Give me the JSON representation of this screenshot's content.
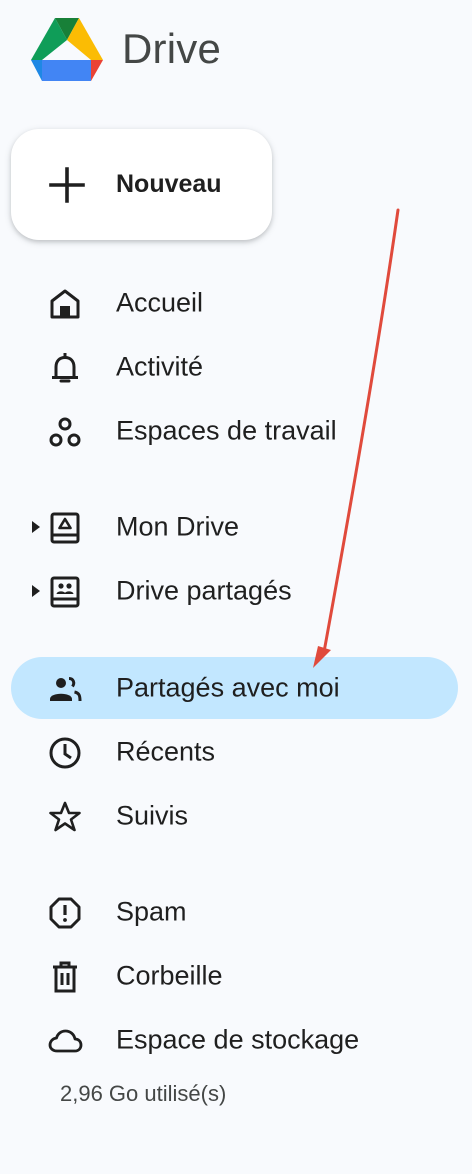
{
  "brand": {
    "title": "Drive",
    "logo_icon": "google-drive-logo"
  },
  "new_button": {
    "label": "Nouveau",
    "icon": "plus-icon"
  },
  "nav": {
    "items": [
      {
        "id": "home",
        "label": "Accueil",
        "icon": "home-icon",
        "active": false
      },
      {
        "id": "activity",
        "label": "Activité",
        "icon": "bell-icon",
        "active": false
      },
      {
        "id": "workspaces",
        "label": "Espaces de travail",
        "icon": "workspaces-icon",
        "active": false
      },
      {
        "id": "my-drive",
        "label": "Mon Drive",
        "icon": "my-drive-icon",
        "expandable": true,
        "active": false
      },
      {
        "id": "shared-drives",
        "label": "Drive partagés",
        "icon": "shared-drives-icon",
        "expandable": true,
        "active": false
      },
      {
        "id": "shared-with-me",
        "label": "Partagés avec moi",
        "icon": "people-icon",
        "active": true
      },
      {
        "id": "recent",
        "label": "Récents",
        "icon": "clock-icon",
        "active": false
      },
      {
        "id": "starred",
        "label": "Suivis",
        "icon": "star-icon",
        "active": false
      },
      {
        "id": "spam",
        "label": "Spam",
        "icon": "spam-icon",
        "active": false
      },
      {
        "id": "trash",
        "label": "Corbeille",
        "icon": "trash-icon",
        "active": false
      },
      {
        "id": "storage",
        "label": "Espace de stockage",
        "icon": "cloud-icon",
        "active": false
      }
    ]
  },
  "storage": {
    "usage_text": "2,96 Go utilisé(s)"
  },
  "colors": {
    "background": "#f8fafd",
    "active_item": "#c2e7ff",
    "annotation_arrow": "#e04a3c",
    "text_primary": "#1f1f1f",
    "text_secondary": "#444746"
  }
}
